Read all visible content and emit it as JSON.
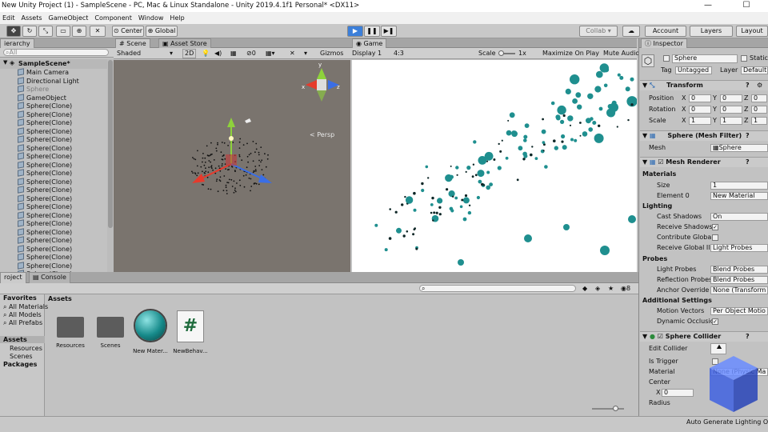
{
  "window": {
    "title": "New Unity Project (1) - SampleScene - PC, Mac & Linux Standalone - Unity 2019.4.1f1 Personal* <DX11>",
    "minimize": "—",
    "maximize": "☐"
  },
  "menu": [
    "Edit",
    "Assets",
    "GameObject",
    "Component",
    "Window",
    "Help"
  ],
  "toolbar": {
    "center": "Center",
    "global": "Global",
    "collab": "Collab ▾",
    "account": "Account",
    "layers": "Layers",
    "layout": "Layout",
    "play": "▶",
    "pause": "❚❚",
    "step": "▶❚"
  },
  "hierarchy": {
    "tab": "ierarchy",
    "search_placeholder": "All",
    "scene": "SampleScene*",
    "items": [
      "Main Camera",
      "Directional Light",
      "Sphere",
      "GameObject",
      "Sphere(Clone)",
      "Sphere(Clone)",
      "Sphere(Clone)",
      "Sphere(Clone)",
      "Sphere(Clone)",
      "Sphere(Clone)",
      "Sphere(Clone)",
      "Sphere(Clone)",
      "Sphere(Clone)",
      "Sphere(Clone)",
      "Sphere(Clone)",
      "Sphere(Clone)",
      "Sphere(Clone)",
      "Sphere(Clone)",
      "Sphere(Clone)",
      "Sphere(Clone)",
      "Sphere(Clone)",
      "Sphere(Clone)",
      "Sphere(Clone)",
      "Sphere(Clone)",
      "Sphere(Clone)"
    ]
  },
  "scene": {
    "tab": "Scene",
    "tab2": "Asset Store",
    "shading": "Shaded",
    "mode2d": "2D",
    "gizmos": "Gizmos",
    "fx": "0",
    "persp": "< Persp"
  },
  "game": {
    "tab": "Game",
    "display": "Display 1",
    "aspect": "4:3",
    "scale_label": "Scale",
    "scale_value": "1x",
    "maximize": "Maximize On Play",
    "mute": "Mute Audio"
  },
  "project": {
    "tab": "roject",
    "tab2": "Console",
    "favorites": "Favorites",
    "fav_items": [
      "All Materials",
      "All Models",
      "All Prefabs"
    ],
    "assets_header": "Assets",
    "tree": [
      "Assets",
      "Resources",
      "Scenes",
      "Packages"
    ],
    "count": "8",
    "files": [
      {
        "name": "Resources",
        "kind": "folder"
      },
      {
        "name": "Scenes",
        "kind": "folder"
      },
      {
        "name": "New Mater...",
        "kind": "material"
      },
      {
        "name": "NewBehav...",
        "kind": "script"
      }
    ]
  },
  "status": "Auto Generate Lighting Off",
  "inspector": {
    "tab": "Inspector",
    "name": "Sphere",
    "static": "Static",
    "tag_label": "Tag",
    "tag": "Untagged",
    "layer_label": "Layer",
    "layer": "Default",
    "transform": {
      "title": "Transform",
      "rows": [
        {
          "label": "Position",
          "x": "0",
          "y": "0",
          "z": "0"
        },
        {
          "label": "Rotation",
          "x": "0",
          "y": "0",
          "z": "0"
        },
        {
          "label": "Scale",
          "x": "1",
          "y": "1",
          "z": "1"
        }
      ]
    },
    "mesh_filter": {
      "title": "Sphere (Mesh Filter)",
      "mesh_label": "Mesh",
      "mesh": "Sphere"
    },
    "mesh_renderer": {
      "title": "Mesh Renderer",
      "materials": "Materials",
      "size_label": "Size",
      "size": "1",
      "element0_label": "Element 0",
      "element0": "New Material",
      "lighting": "Lighting",
      "cast_label": "Cast Shadows",
      "cast": "On",
      "receive_label": "Receive Shadows",
      "contribute_label": "Contribute Global",
      "receive_gi_label": "Receive Global Illu",
      "receive_gi": "Light Probes",
      "probes": "Probes",
      "light_probes_label": "Light Probes",
      "light_probes": "Blend Probes",
      "reflection_label": "Reflection Probes",
      "reflection": "Blend Probes",
      "anchor_label": "Anchor Override",
      "anchor": "None (Transform",
      "additional": "Additional Settings",
      "motion_label": "Motion Vectors",
      "motion": "Per Object Motio",
      "dynamic_label": "Dynamic Occlusic"
    },
    "collider": {
      "title": "Sphere Collider",
      "edit_label": "Edit Collider",
      "trigger_label": "Is Trigger",
      "material_label": "Material",
      "material": "None (Physic Ma",
      "center_label": "Center",
      "cx": "0",
      "radius_label": "Radius"
    }
  },
  "colors": {
    "play": "#3c7fd9",
    "ball": "#1f8f8f",
    "scene_bg": "#7a746e"
  }
}
